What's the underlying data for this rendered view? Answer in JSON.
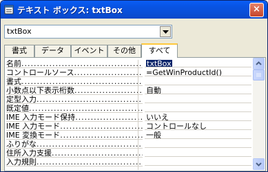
{
  "window": {
    "title": "テキスト ボックス: txtBox",
    "close_label": "×"
  },
  "object_combo": {
    "value": "txtBox"
  },
  "tabs": [
    "書式",
    "データ",
    "イベント",
    "その他",
    "すべて"
  ],
  "active_tab": "すべて",
  "properties": [
    {
      "name": "名前",
      "value": "txtBox",
      "selected": true
    },
    {
      "name": "コントロールソース",
      "value": "=GetWinProductId()"
    },
    {
      "name": "書式",
      "value": ""
    },
    {
      "name": "小数点以下表示桁数",
      "value": "自動"
    },
    {
      "name": "定型入力",
      "value": ""
    },
    {
      "name": "既定値",
      "value": ""
    },
    {
      "name": "IME 入力モード保持",
      "value": "いいえ"
    },
    {
      "name": "IME 入力モード",
      "value": "コントロールなし"
    },
    {
      "name": "IME 変換モード",
      "value": "一般"
    },
    {
      "name": "ふりがな",
      "value": ""
    },
    {
      "name": "住所入力支援",
      "value": ""
    },
    {
      "name": "入力規則",
      "value": ""
    }
  ],
  "colors": {
    "title_bar": "#0a4fd7",
    "selection": "#0a246a",
    "active_tab_accent": "#ffc83c"
  }
}
